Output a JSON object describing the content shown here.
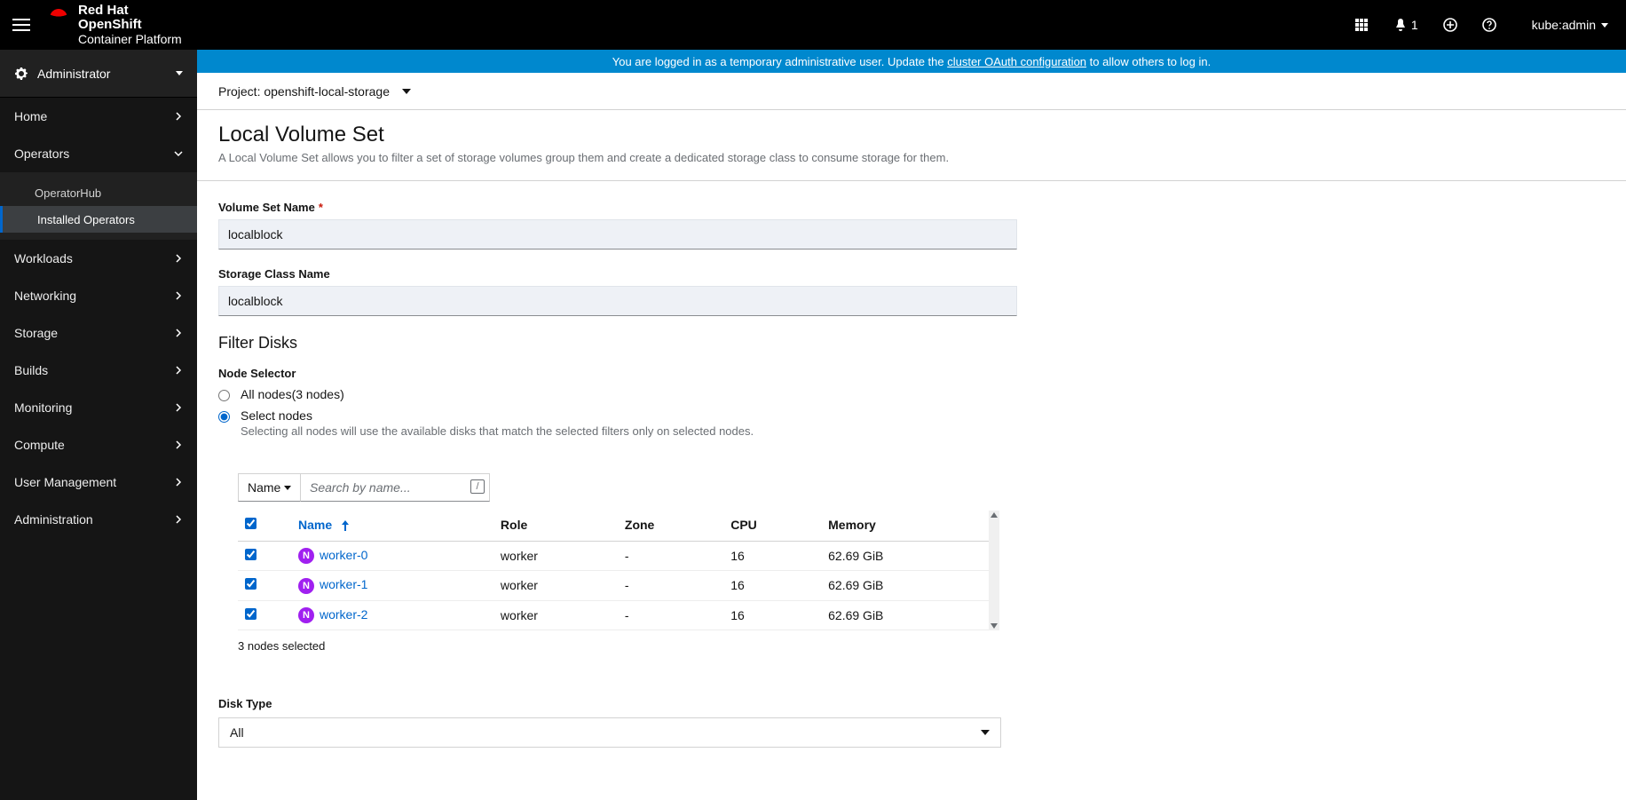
{
  "masthead": {
    "brand_bold": "Red Hat",
    "brand_mid": "OpenShift",
    "brand_sub": "Container Platform",
    "notif_count": "1",
    "user": "kube:admin"
  },
  "banner": {
    "prefix": "You are logged in as a temporary administrative user. Update the ",
    "link": "cluster OAuth configuration",
    "suffix": " to allow others to log in."
  },
  "sidebar": {
    "perspective": "Administrator",
    "items": [
      {
        "label": "Home",
        "expanded": false
      },
      {
        "label": "Operators",
        "expanded": true,
        "children": [
          {
            "label": "OperatorHub",
            "active": false
          },
          {
            "label": "Installed Operators",
            "active": true
          }
        ]
      },
      {
        "label": "Workloads",
        "expanded": false
      },
      {
        "label": "Networking",
        "expanded": false
      },
      {
        "label": "Storage",
        "expanded": false
      },
      {
        "label": "Builds",
        "expanded": false
      },
      {
        "label": "Monitoring",
        "expanded": false
      },
      {
        "label": "Compute",
        "expanded": false
      },
      {
        "label": "User Management",
        "expanded": false
      },
      {
        "label": "Administration",
        "expanded": false
      }
    ]
  },
  "project": {
    "label": "Project:",
    "value": "openshift-local-storage"
  },
  "page": {
    "title": "Local Volume Set",
    "description": "A Local Volume Set allows you to filter a set of storage volumes group them and create a dedicated storage class to consume storage for them."
  },
  "form": {
    "vsn_label": "Volume Set Name",
    "vsn_value": "localblock",
    "scn_label": "Storage Class Name",
    "scn_value": "localblock",
    "filter_heading": "Filter Disks",
    "node_selector_label": "Node Selector",
    "radio_all": "All nodes(3 nodes)",
    "radio_select": "Select nodes",
    "select_help": "Selecting all nodes will use the available disks that match the selected filters only on selected nodes.",
    "filter_dd": "Name",
    "search_placeholder": "Search by name...",
    "slash": "/",
    "columns": {
      "name": "Name",
      "role": "Role",
      "zone": "Zone",
      "cpu": "CPU",
      "memory": "Memory"
    },
    "rows": [
      {
        "name": "worker-0",
        "role": "worker",
        "zone": "-",
        "cpu": "16",
        "memory": "62.69 GiB"
      },
      {
        "name": "worker-1",
        "role": "worker",
        "zone": "-",
        "cpu": "16",
        "memory": "62.69 GiB"
      },
      {
        "name": "worker-2",
        "role": "worker",
        "zone": "-",
        "cpu": "16",
        "memory": "62.69 GiB"
      }
    ],
    "selected_note": "3 nodes selected",
    "disk_type_label": "Disk Type",
    "disk_type_value": "All"
  }
}
